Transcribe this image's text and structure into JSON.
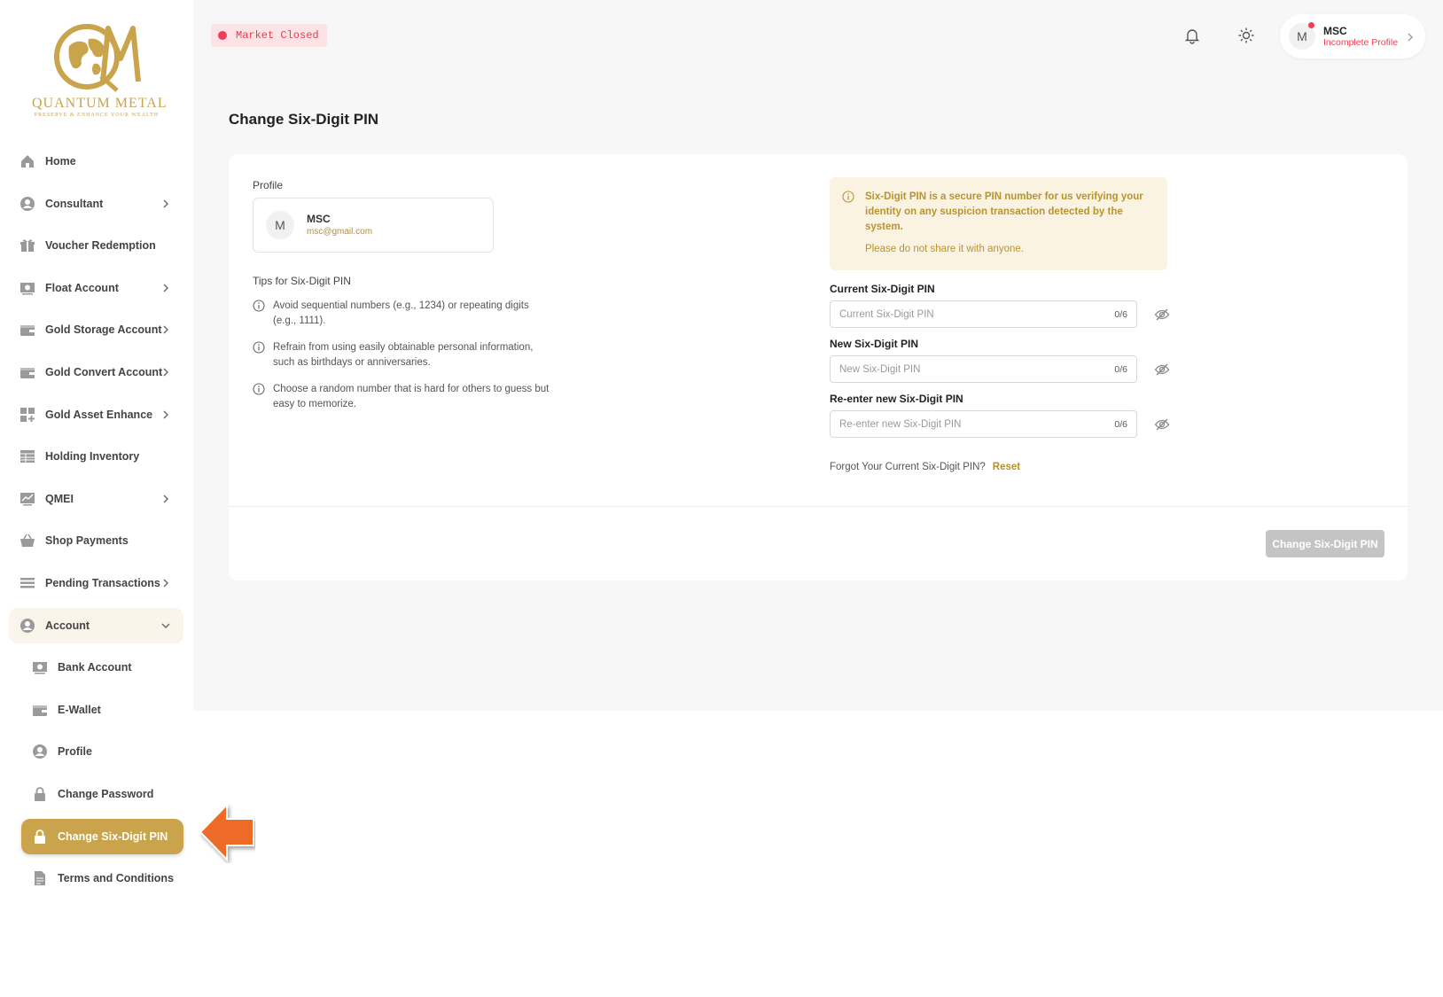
{
  "brand": {
    "name": "QUANTUM METAL",
    "tagline": "PRESERVE & ENHANCE YOUR WEALTH",
    "color": "#c9a44c"
  },
  "sidebar": {
    "items": [
      {
        "label": "Home",
        "icon": "home-icon",
        "chevron": false
      },
      {
        "label": "Consultant",
        "icon": "user-circle-icon",
        "chevron": true
      },
      {
        "label": "Voucher Redemption",
        "icon": "gift-icon",
        "chevron": false
      },
      {
        "label": "Float Account",
        "icon": "banknote-icon",
        "chevron": true
      },
      {
        "label": "Gold Storage Account",
        "icon": "wallet-icon",
        "chevron": true
      },
      {
        "label": "Gold Convert Account",
        "icon": "wallet-icon",
        "chevron": true
      },
      {
        "label": "Gold Asset Enhance",
        "icon": "grid-plus-icon",
        "chevron": true
      },
      {
        "label": "Holding Inventory",
        "icon": "table-icon",
        "chevron": false
      },
      {
        "label": "QMEI",
        "icon": "chart-icon",
        "chevron": true
      },
      {
        "label": "Shop Payments",
        "icon": "basket-icon",
        "chevron": false
      },
      {
        "label": "Pending Transactions",
        "icon": "list-icon",
        "chevron": true
      },
      {
        "label": "Account",
        "icon": "user-circle-icon",
        "chevron": true,
        "expanded": true
      }
    ],
    "account_sub": [
      {
        "label": "Bank Account",
        "icon": "banknote-icon"
      },
      {
        "label": "E-Wallet",
        "icon": "wallet-icon"
      },
      {
        "label": "Profile",
        "icon": "user-circle-icon"
      },
      {
        "label": "Change Password",
        "icon": "lock-icon"
      },
      {
        "label": "Change Six-Digit PIN",
        "icon": "lock-icon",
        "active": true
      },
      {
        "label": "Terms and Conditions",
        "icon": "document-icon"
      }
    ]
  },
  "header": {
    "market_status": "Market Closed",
    "market_status_color": "#ef3e57",
    "user": {
      "initial": "M",
      "name": "MSC",
      "status": "Incomplete Profile"
    }
  },
  "page": {
    "title": "Change Six-Digit PIN",
    "profile_label": "Profile",
    "profile": {
      "initial": "M",
      "name": "MSC",
      "email": "msc@gmail.com"
    },
    "tips_title": "Tips for Six-Digit PIN",
    "tips": [
      "Avoid sequential numbers (e.g., 1234) or repeating digits (e.g., 1111).",
      "Refrain from using easily obtainable personal information, such as birthdays or anniversaries.",
      "Choose a random number that is hard for others to guess but easy to memorize."
    ],
    "alert": {
      "main": "Six-Digit PIN is a secure PIN number for us verifying your identity on any suspicion transaction detected by the system.",
      "note": "Please do not share it with anyone."
    },
    "fields": [
      {
        "label": "Current Six-Digit PIN",
        "placeholder": "Current Six-Digit PIN",
        "value": "",
        "count": "0/6"
      },
      {
        "label": "New Six-Digit PIN",
        "placeholder": "New Six-Digit PIN",
        "value": "",
        "count": "0/6"
      },
      {
        "label": "Re-enter new Six-Digit PIN",
        "placeholder": "Re-enter new Six-Digit PIN",
        "value": "",
        "count": "0/6"
      }
    ],
    "forgot_text": "Forgot Your Current Six-Digit PIN?",
    "reset_label": "Reset",
    "submit_label": "Change Six-Digit PIN"
  }
}
